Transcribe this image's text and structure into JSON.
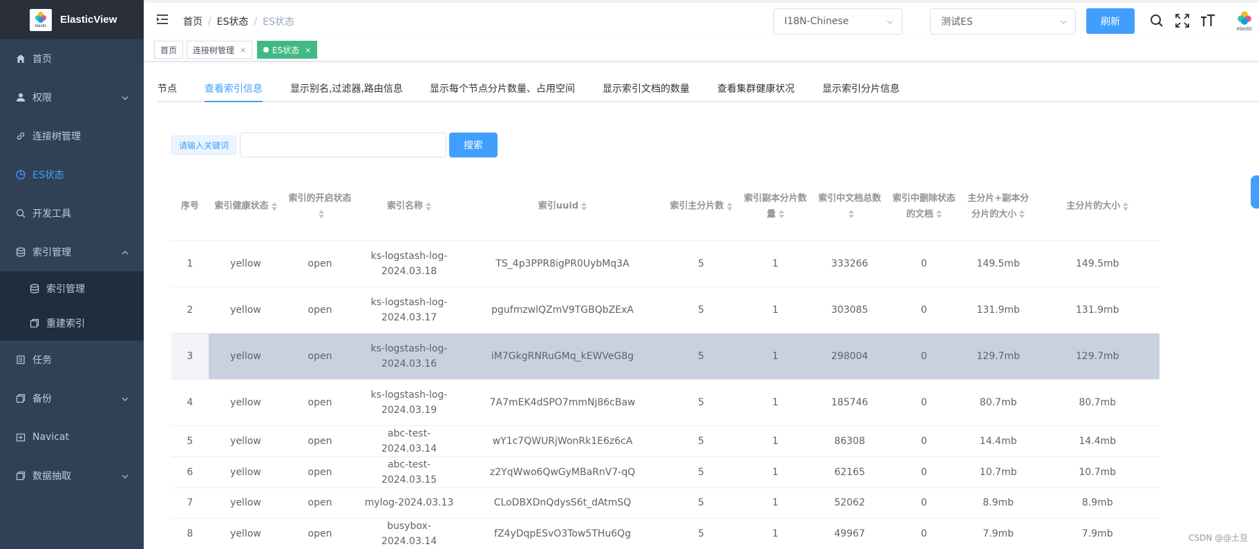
{
  "sidebar": {
    "app_title": "ElasticView",
    "logo_small_text": "elastic",
    "items": [
      {
        "label": "首页",
        "icon": "home-icon"
      },
      {
        "label": "权限",
        "icon": "user-icon"
      },
      {
        "label": "连接树管理",
        "icon": "link-icon"
      },
      {
        "label": "ES状态",
        "icon": "pie-chart-icon"
      },
      {
        "label": "开发工具",
        "icon": "search-icon"
      },
      {
        "label": "索引管理",
        "icon": "database-icon"
      },
      {
        "label": "索引管理",
        "icon": "database-icon"
      },
      {
        "label": "重建索引",
        "icon": "copy-icon"
      },
      {
        "label": "任务",
        "icon": "document-icon"
      },
      {
        "label": "备份",
        "icon": "copy-icon"
      },
      {
        "label": "Navicat",
        "icon": "plus-box-icon"
      },
      {
        "label": "数据抽取",
        "icon": "copy-icon"
      }
    ]
  },
  "header": {
    "breadcrumb": [
      "首页",
      "ES状态",
      "ES状态"
    ],
    "language_select": "I18N-Chinese",
    "connection_select": "测试ES",
    "refresh_label": "刷新",
    "logo_small_text": "elastic"
  },
  "tags": [
    {
      "label": "首页"
    },
    {
      "label": "连接树管理",
      "close": "×"
    },
    {
      "label": "ES状态",
      "close": "×"
    }
  ],
  "tabs": [
    "节点",
    "查看索引信息",
    "显示别名,过滤器,路由信息",
    "显示每个节点分片数量、占用空间",
    "显示索引文档的数量",
    "查看集群健康状况",
    "显示索引分片信息"
  ],
  "search": {
    "label": "请输入关键词",
    "placeholder": "",
    "value": "",
    "button_label": "搜索"
  },
  "table": {
    "columns": [
      "序号",
      "索引健康状态",
      "索引的开启状态",
      "索引名称",
      "索引uuid",
      "索引主分片数",
      "索引副本分片数量",
      "索引中文档总数",
      "索引中删除状态的文档",
      "主分片+副本分分片的大小",
      "主分片的大小"
    ],
    "rows": [
      [
        "1",
        "yellow",
        "open",
        "ks-logstash-log-2024.03.18",
        "TS_4p3PPR8igPR0UybMq3A",
        "5",
        "1",
        "333266",
        "0",
        "149.5mb",
        "149.5mb"
      ],
      [
        "2",
        "yellow",
        "open",
        "ks-logstash-log-2024.03.17",
        "pgufmzwlQZmV9TGBQbZExA",
        "5",
        "1",
        "303085",
        "0",
        "131.9mb",
        "131.9mb"
      ],
      [
        "3",
        "yellow",
        "open",
        "ks-logstash-log-2024.03.16",
        "iM7GkgRNRuGMq_kEWVeG8g",
        "5",
        "1",
        "298004",
        "0",
        "129.7mb",
        "129.7mb"
      ],
      [
        "4",
        "yellow",
        "open",
        "ks-logstash-log-2024.03.19",
        "7A7mEK4dSPO7mmNj86cBaw",
        "5",
        "1",
        "185746",
        "0",
        "80.7mb",
        "80.7mb"
      ],
      [
        "5",
        "yellow",
        "open",
        "abc-test-2024.03.14",
        "wY1c7QWURjWonRk1E6z6cA",
        "5",
        "1",
        "86308",
        "0",
        "14.4mb",
        "14.4mb"
      ],
      [
        "6",
        "yellow",
        "open",
        "abc-test-2024.03.15",
        "z2YqWwo6QwGyMBaRnV7-qQ",
        "5",
        "1",
        "62165",
        "0",
        "10.7mb",
        "10.7mb"
      ],
      [
        "7",
        "yellow",
        "open",
        "mylog-2024.03.13",
        "CLoDBXDnQdysS6t_dAtmSQ",
        "5",
        "1",
        "52062",
        "0",
        "8.9mb",
        "8.9mb"
      ],
      [
        "8",
        "yellow",
        "open",
        "busybox-2024.03.14",
        "fZ4yDqpESvO3Tow5THu6Qg",
        "5",
        "1",
        "49967",
        "0",
        "7.9mb",
        "7.9mb"
      ]
    ]
  },
  "watermark": "CSDN @@土豆",
  "colors": {
    "sidebar_bg": "#304156",
    "accent": "#409eff",
    "tag_active": "#42b983",
    "row_highlight": "#c9d0e0"
  }
}
